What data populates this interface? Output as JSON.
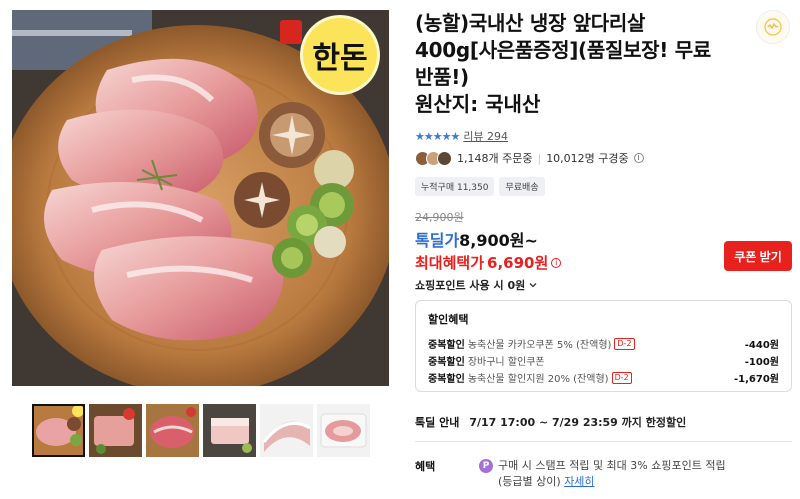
{
  "product": {
    "title": "(농할)국내산 냉장 앞다리살 400g[사은품증정](품질보장! 무료반품!)",
    "origin": "원산지: 국내산",
    "image_logo_text": "한돈"
  },
  "rating": {
    "stars": "★★★★★",
    "review_label": "리뷰 294"
  },
  "orders": {
    "orders_text": "1,148개 주문중",
    "viewers_text": "10,012명 구경중"
  },
  "tags": [
    "누적구매 11,350",
    "무료배송"
  ],
  "price": {
    "original": "24,900원",
    "deal_label": "톡딜가",
    "deal_value": "8,900원~",
    "max_label": "최대혜택가",
    "max_value": "6,690원",
    "coupon_button": "쿠폰 받기",
    "points_text": "쇼핑포인트 사용 시 0원"
  },
  "discount": {
    "title": "할인혜택",
    "rows": [
      {
        "type": "중복할인",
        "desc": "농축산물 카카오쿠폰 5% (잔액형)",
        "badge": "D-2",
        "amount": "-440원"
      },
      {
        "type": "중복할인",
        "desc": "장바구니 할인쿠폰",
        "badge": "",
        "amount": "-100원"
      },
      {
        "type": "중복할인",
        "desc": "농축산물 할인지원 20% (잔액형)",
        "badge": "D-2",
        "amount": "-1,670원"
      }
    ]
  },
  "deal_notice": {
    "label": "톡딜 안내",
    "text": "7/17 17:00 ~ 7/29 23:59 까지 한정할인"
  },
  "benefit": {
    "label": "혜택",
    "badge": "P",
    "line1": "구매 시 스탬프 적립 및 최대 3% 쇼핑포인트 적립",
    "line2_prefix": "(등급별 상이)",
    "more_link": "자세히"
  },
  "colors": {
    "accent_blue": "#2b6ed2",
    "accent_red": "#e8201e",
    "point_purple": "#a570d6"
  }
}
